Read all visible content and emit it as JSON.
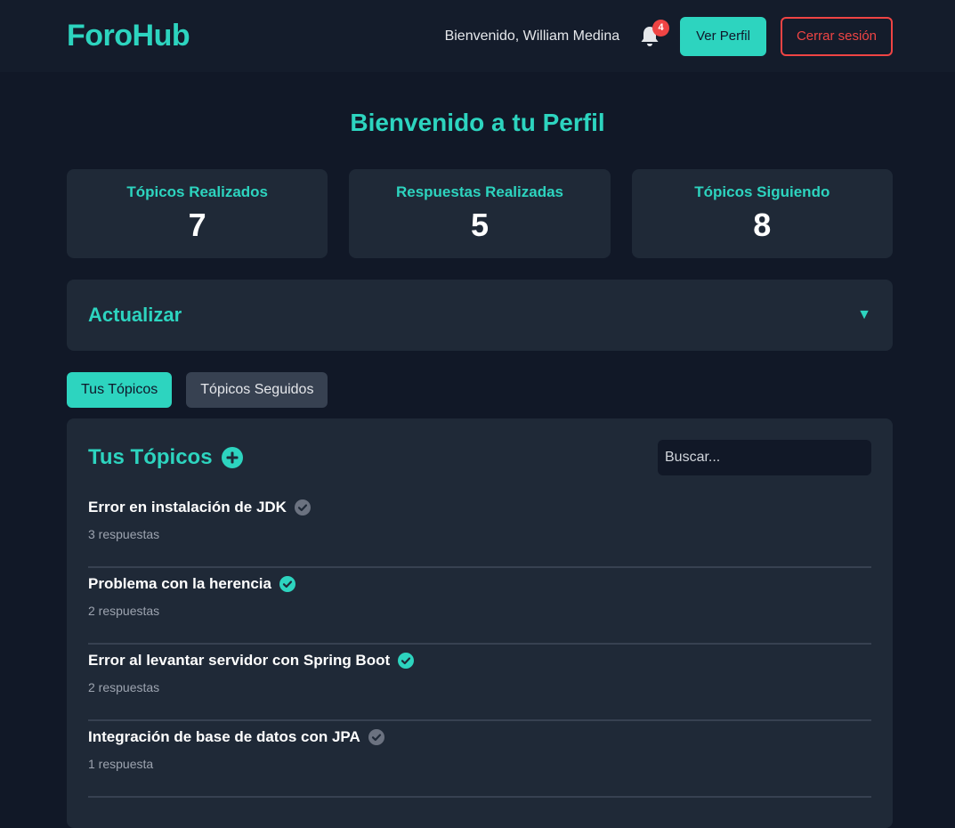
{
  "nav": {
    "brand": "ForoHub",
    "welcome": "Bienvenido, William Medina",
    "notification_count": "4",
    "profile_button": "Ver Perfil",
    "logout_button": "Cerrar sesión"
  },
  "page": {
    "title": "Bienvenido a tu Perfil"
  },
  "stats": [
    {
      "label": "Tópicos Realizados",
      "value": "7"
    },
    {
      "label": "Respuestas Realizadas",
      "value": "5"
    },
    {
      "label": "Tópicos Siguiendo",
      "value": "8"
    }
  ],
  "update": {
    "title": "Actualizar",
    "arrow": "▼"
  },
  "tabs": [
    {
      "label": "Tus Tópicos",
      "active": true
    },
    {
      "label": "Tópicos Seguidos",
      "active": false
    }
  ],
  "topics": {
    "title": "Tus Tópicos",
    "search_placeholder": "Buscar...",
    "items": [
      {
        "title": "Error en instalación de JDK",
        "meta": "3 respuestas",
        "solved": false
      },
      {
        "title": "Problema con la herencia",
        "meta": "2 respuestas",
        "solved": true
      },
      {
        "title": "Error al levantar servidor con Spring Boot",
        "meta": "2 respuestas",
        "solved": true
      },
      {
        "title": "Integración de base de datos con JPA",
        "meta": "1 respuesta",
        "solved": false
      }
    ]
  },
  "colors": {
    "accent": "#2dd4bf",
    "danger": "#ef4444",
    "check_solved": "#2dd4bf",
    "check_unsolved": "#6b7280"
  },
  "icons": {
    "notification": "bell-icon",
    "add": "plus-circle-icon",
    "solved": "check-circle-icon",
    "dropdown": "chevron-down-icon"
  }
}
